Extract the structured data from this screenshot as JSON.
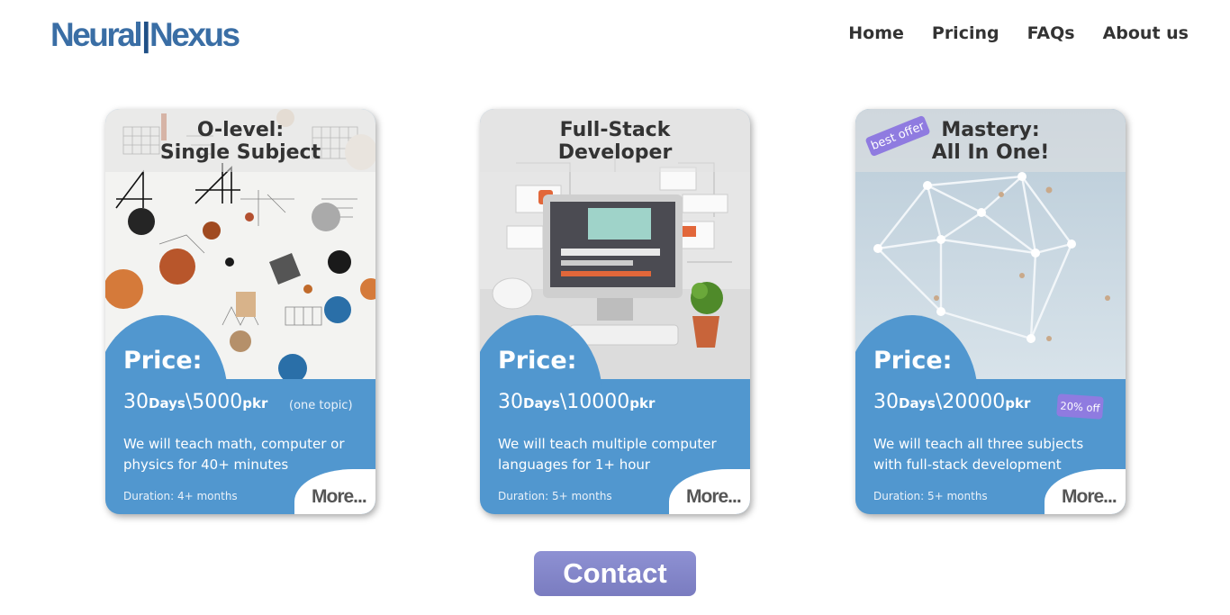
{
  "header": {
    "logo_left": "Neural",
    "logo_sep": "|",
    "logo_right": "Nexus",
    "nav": [
      "Home",
      "Pricing",
      "FAQs",
      "About us"
    ]
  },
  "cards": [
    {
      "title_line1": "O-level:",
      "title_line2": "Single Subject",
      "price_label": "Price:",
      "days": "30",
      "days_unit": "Days",
      "sep": "\\",
      "amount": "5000",
      "currency": "pkr",
      "note": "(one topic)",
      "desc": "We will teach math, computer or physics for 40+ minutes",
      "duration": "Duration: 4+ months",
      "more": "More..."
    },
    {
      "title_line1": "Full-Stack",
      "title_line2": "Developer",
      "price_label": "Price:",
      "days": "30",
      "days_unit": "Days",
      "sep": "\\",
      "amount": "10000",
      "currency": "pkr",
      "desc": "We will teach multiple computer languages for 1+ hour",
      "duration": "Duration: 5+ months",
      "more": "More..."
    },
    {
      "badge": "best offer",
      "title_line1": "Mastery:",
      "title_line2": "All In One!",
      "price_label": "Price:",
      "days": "30",
      "days_unit": "Days",
      "sep": "\\",
      "amount": "20000",
      "currency": "pkr",
      "discount": "20% off",
      "desc": "We will teach all three subjects with full-stack development",
      "duration": "Duration: 5+ months",
      "more": "More..."
    }
  ],
  "contact": {
    "label": "Contact"
  },
  "colors": {
    "brand": "#3a6ea5",
    "card": "#5197cf",
    "accent": "#8f7be0",
    "button": "#8587cb"
  }
}
